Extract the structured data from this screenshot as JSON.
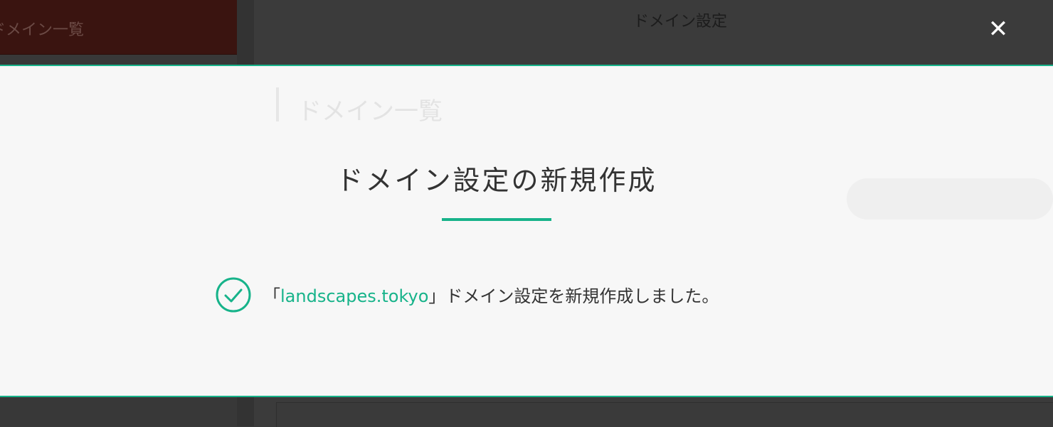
{
  "background": {
    "sidebar_active_label": "ドメイン一覧",
    "header_title": "ドメイン設定",
    "section_heading": "ドメイン一覧",
    "close_icon": "close-icon"
  },
  "modal": {
    "title": "ドメイン設定の新規作成",
    "message_prefix": "「",
    "domain": "landscapes.tokyo",
    "message_suffix": "」ドメイン設定を新規作成しました。",
    "status_icon": "check-circle-icon"
  },
  "colors": {
    "accent": "#17b38a",
    "overlay_bg": "#3b3b3b",
    "modal_bg": "#f7f7f7"
  }
}
